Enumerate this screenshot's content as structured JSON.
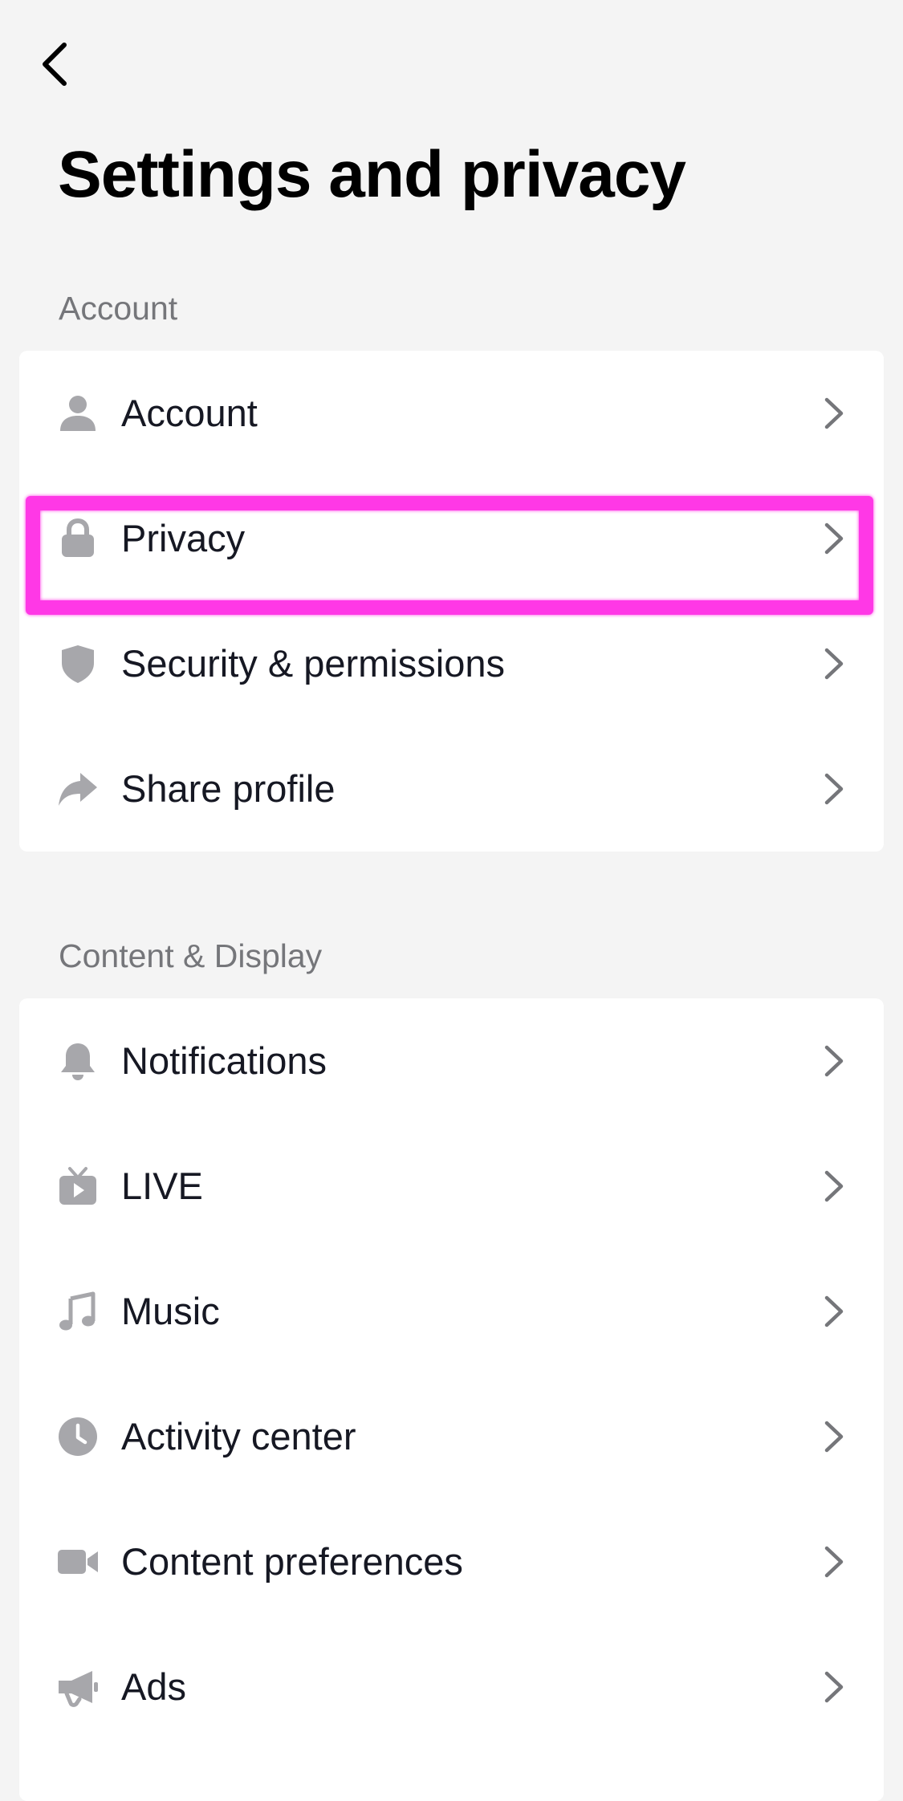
{
  "page": {
    "title": "Settings and privacy"
  },
  "sections": [
    {
      "header": "Account",
      "items": [
        {
          "label": "Account",
          "icon": "person-icon"
        },
        {
          "label": "Privacy",
          "icon": "lock-icon"
        },
        {
          "label": "Security & permissions",
          "icon": "shield-icon"
        },
        {
          "label": "Share profile",
          "icon": "share-icon"
        }
      ]
    },
    {
      "header": "Content & Display",
      "items": [
        {
          "label": "Notifications",
          "icon": "bell-icon"
        },
        {
          "label": "LIVE",
          "icon": "live-tv-icon"
        },
        {
          "label": "Music",
          "icon": "music-note-icon"
        },
        {
          "label": "Activity center",
          "icon": "clock-icon"
        },
        {
          "label": "Content preferences",
          "icon": "video-camera-icon"
        },
        {
          "label": "Ads",
          "icon": "megaphone-icon"
        }
      ]
    }
  ],
  "colors": {
    "background": "#f4f4f4",
    "card": "#ffffff",
    "icon_gray": "#a7a7ab",
    "chevron_gray": "#75767a",
    "highlight": "#ff38e6"
  }
}
